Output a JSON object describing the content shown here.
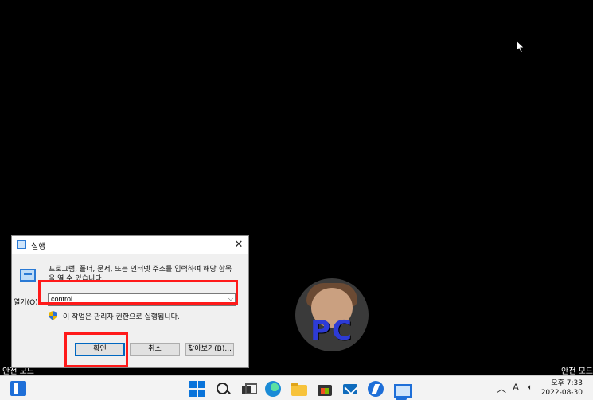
{
  "desktop": {
    "safe_mode_left": "안전 모드",
    "safe_mode_right": "안전 모드"
  },
  "watermark": {
    "text": "PC"
  },
  "run_dialog": {
    "title": "실행",
    "description": "프로그램, 폴더, 문서, 또는 인터넷 주소를 입력하여 해당 항목을 열 수 있습니다.",
    "open_label": "열기(O):",
    "open_value": "control",
    "admin_note": "이 작업은 관리자 권한으로 실행됩니다.",
    "ok_label": "확인",
    "cancel_label": "취소",
    "browse_label": "찾아보기(B)..."
  },
  "taskbar": {
    "icons": [
      "widgets-icon",
      "start-icon",
      "search-icon",
      "task-view-icon",
      "edge-icon",
      "file-explorer-icon",
      "store-icon",
      "mail-icon",
      "app-icon",
      "run-icon"
    ],
    "ime": "A",
    "time": "오후 7:33",
    "date": "2022-08-30"
  },
  "annotations": {
    "highlight_color": "#ff1a1a"
  }
}
